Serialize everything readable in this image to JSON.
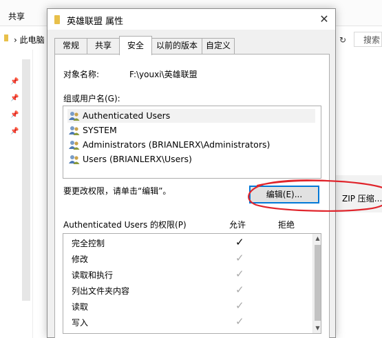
{
  "explorer": {
    "ribbon_tab": "共享",
    "address_path": "此电脑",
    "refresh_glyph": "↻",
    "search_placeholder": "搜索",
    "pin_glyph": "📌",
    "zip_text": "ZIP 压缩..."
  },
  "dialog": {
    "title": "英雄联盟 属性",
    "close_glyph": "✕",
    "tabs": [
      {
        "label": "常规"
      },
      {
        "label": "共享"
      },
      {
        "label": "安全"
      },
      {
        "label": "以前的版本"
      },
      {
        "label": "自定义"
      }
    ],
    "active_tab": "安全",
    "object_label": "对象名称:",
    "object_value": "F:\\youxi\\英雄联盟",
    "group_label": "组或用户名(G):",
    "users": [
      {
        "name": "Authenticated Users"
      },
      {
        "name": "SYSTEM"
      },
      {
        "name": "Administrators (BRIANLERX\\Administrators)"
      },
      {
        "name": "Users (BRIANLERX\\Users)"
      }
    ],
    "change_hint": "要更改权限，请单击“编辑”。",
    "edit_button": "编辑(E)...",
    "permissions_title": "Authenticated Users 的权限(P)",
    "allow_header": "允许",
    "deny_header": "拒绝",
    "check_glyph": "✓",
    "scroll_up_glyph": "▲",
    "scroll_down_glyph": "▼",
    "permissions": [
      {
        "name": "完全控制",
        "allow": "enabled"
      },
      {
        "name": "修改",
        "allow": "inherited"
      },
      {
        "name": "读取和执行",
        "allow": "inherited"
      },
      {
        "name": "列出文件夹内容",
        "allow": "inherited"
      },
      {
        "name": "读取",
        "allow": "inherited"
      },
      {
        "name": "写入",
        "allow": "inherited"
      }
    ]
  },
  "colors": {
    "accent": "#0078d7",
    "annotation_red": "#e0242b",
    "folder_yellow": "#e8c04a"
  }
}
